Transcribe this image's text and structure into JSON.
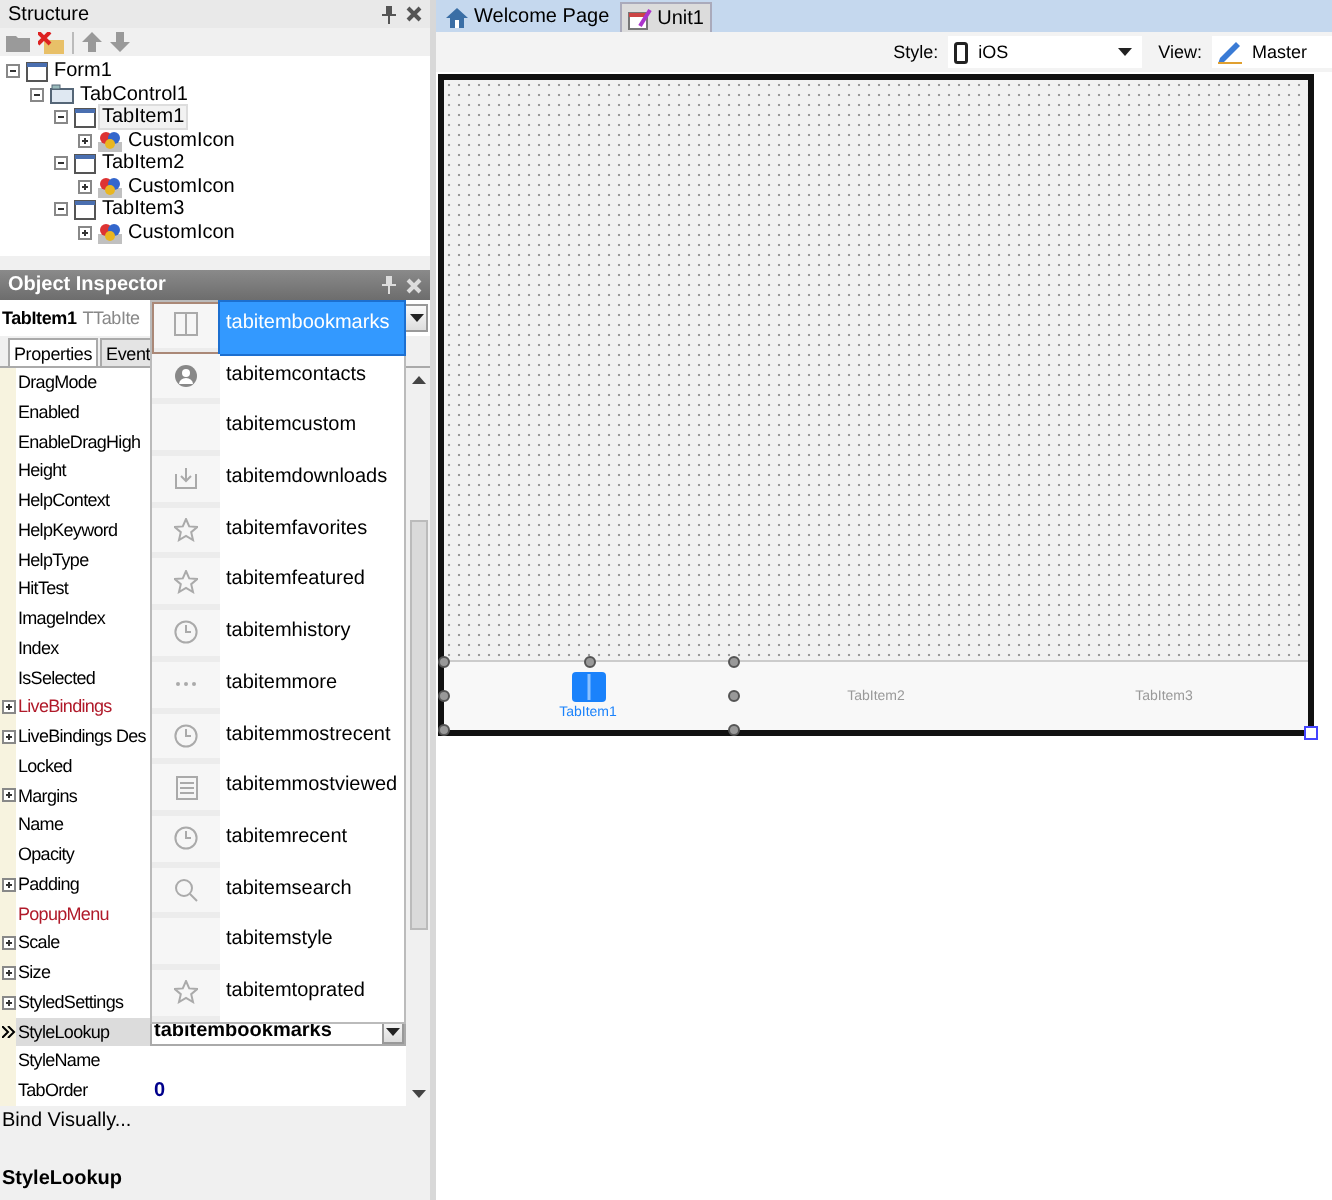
{
  "structure": {
    "title": "Structure",
    "tree": [
      {
        "label": "Form1",
        "kind": "form",
        "expanded": true,
        "selected": false,
        "children": [
          {
            "label": "TabControl1",
            "kind": "tabcontrol",
            "expanded": true,
            "selected": false,
            "children": [
              {
                "label": "TabItem1",
                "kind": "tabitem",
                "expanded": true,
                "selected": true,
                "children": [
                  {
                    "label": "CustomIcon",
                    "kind": "customicon",
                    "expanded": false,
                    "selected": false
                  }
                ]
              },
              {
                "label": "TabItem2",
                "kind": "tabitem",
                "expanded": true,
                "selected": false,
                "children": [
                  {
                    "label": "CustomIcon",
                    "kind": "customicon",
                    "expanded": false,
                    "selected": false
                  }
                ]
              },
              {
                "label": "TabItem3",
                "kind": "tabitem",
                "expanded": true,
                "selected": false,
                "children": [
                  {
                    "label": "CustomIcon",
                    "kind": "customicon",
                    "expanded": false,
                    "selected": false
                  }
                ]
              }
            ]
          }
        ]
      }
    ]
  },
  "inspector": {
    "title": "Object Inspector",
    "object_name": "TabItem1",
    "object_type": "TTabIte",
    "tabs": [
      {
        "label": "Properties",
        "selected": true
      },
      {
        "label": "Event",
        "selected": false
      }
    ],
    "properties": [
      {
        "name": "DragMode",
        "expandable": false,
        "reference": false,
        "selected": false
      },
      {
        "name": "Enabled",
        "expandable": false,
        "reference": false,
        "selected": false
      },
      {
        "name": "EnableDragHigh",
        "expandable": false,
        "reference": false,
        "selected": false
      },
      {
        "name": "Height",
        "expandable": false,
        "reference": false,
        "selected": false
      },
      {
        "name": "HelpContext",
        "expandable": false,
        "reference": false,
        "selected": false
      },
      {
        "name": "HelpKeyword",
        "expandable": false,
        "reference": false,
        "selected": false
      },
      {
        "name": "HelpType",
        "expandable": false,
        "reference": false,
        "selected": false
      },
      {
        "name": "HitTest",
        "expandable": false,
        "reference": false,
        "selected": false
      },
      {
        "name": "ImageIndex",
        "expandable": false,
        "reference": false,
        "selected": false
      },
      {
        "name": "Index",
        "expandable": false,
        "reference": false,
        "selected": false
      },
      {
        "name": "IsSelected",
        "expandable": false,
        "reference": false,
        "selected": false
      },
      {
        "name": "LiveBindings",
        "expandable": true,
        "reference": true,
        "selected": false
      },
      {
        "name": "LiveBindings Des",
        "expandable": true,
        "reference": false,
        "selected": false
      },
      {
        "name": "Locked",
        "expandable": false,
        "reference": false,
        "selected": false
      },
      {
        "name": "Margins",
        "expandable": true,
        "reference": false,
        "selected": false
      },
      {
        "name": "Name",
        "expandable": false,
        "reference": false,
        "selected": false
      },
      {
        "name": "Opacity",
        "expandable": false,
        "reference": false,
        "selected": false
      },
      {
        "name": "Padding",
        "expandable": true,
        "reference": false,
        "selected": false
      },
      {
        "name": "PopupMenu",
        "expandable": false,
        "reference": true,
        "selected": false
      },
      {
        "name": "Scale",
        "expandable": true,
        "reference": false,
        "selected": false
      },
      {
        "name": "Size",
        "expandable": true,
        "reference": false,
        "selected": false
      },
      {
        "name": "StyledSettings",
        "expandable": true,
        "reference": false,
        "selected": false
      },
      {
        "name": "StyleLookup",
        "expandable": false,
        "reference": false,
        "selected": true,
        "value": "tabitembookmarks"
      },
      {
        "name": "StyleName",
        "expandable": false,
        "reference": false,
        "selected": false
      },
      {
        "name": "TabOrder",
        "expandable": false,
        "reference": false,
        "selected": false,
        "value": "0"
      }
    ],
    "dropdown": [
      {
        "label": "tabitembookmarks",
        "kind": "book",
        "selected": true
      },
      {
        "label": "tabitemcontacts",
        "kind": "person",
        "selected": false
      },
      {
        "label": "tabitemcustom",
        "kind": "blank",
        "selected": false
      },
      {
        "label": "tabitemdownloads",
        "kind": "download",
        "selected": false
      },
      {
        "label": "tabitemfavorites",
        "kind": "star",
        "selected": false
      },
      {
        "label": "tabitemfeatured",
        "kind": "star",
        "selected": false
      },
      {
        "label": "tabitemhistory",
        "kind": "clock",
        "selected": false
      },
      {
        "label": "tabitemmore",
        "kind": "dots",
        "selected": false
      },
      {
        "label": "tabitemmostrecent",
        "kind": "clock",
        "selected": false
      },
      {
        "label": "tabitemmostviewed",
        "kind": "list",
        "selected": false
      },
      {
        "label": "tabitemrecent",
        "kind": "clock",
        "selected": false
      },
      {
        "label": "tabitemsearch",
        "kind": "search",
        "selected": false
      },
      {
        "label": "tabitemstyle",
        "kind": "blank",
        "selected": false
      },
      {
        "label": "tabitemtoprated",
        "kind": "star",
        "selected": false
      }
    ],
    "bind_link": "Bind Visually...",
    "description": "StyleLookup"
  },
  "editor": {
    "tabs": [
      {
        "label": "Welcome Page",
        "kind": "home",
        "selected": false
      },
      {
        "label": "Unit1",
        "kind": "unit",
        "selected": true
      }
    ],
    "style_label": "Style:",
    "style_value": "iOS",
    "view_label": "View:",
    "view_value": "Master",
    "form_tabs": [
      {
        "label": "TabItem1",
        "selected": true
      },
      {
        "label": "TabItem2",
        "selected": false
      },
      {
        "label": "TabItem3",
        "selected": false
      }
    ]
  }
}
